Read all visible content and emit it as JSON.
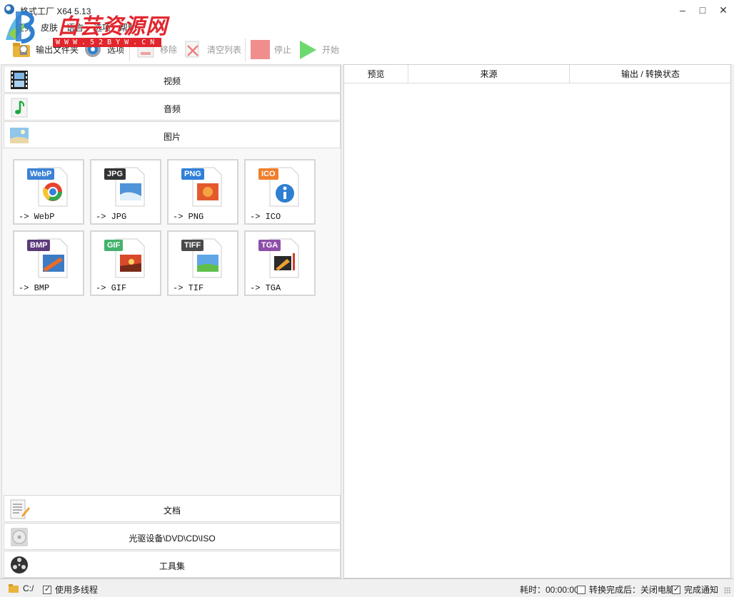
{
  "window": {
    "title": "格式工厂 X64 5.13",
    "minimize_glyph": "–",
    "maximize_glyph": "□",
    "close_glyph": "✕"
  },
  "watermark": {
    "text": "白芸资源网",
    "url": "WWW.52BYW.CN"
  },
  "menu": [
    "任务",
    "皮肤",
    "语言",
    "选项",
    "帮助"
  ],
  "toolbar": {
    "output_folder": "输出文件夹",
    "options": "选项",
    "remove": "移除",
    "clear_list": "清空列表",
    "stop": "停止",
    "start": "开始"
  },
  "categories_top": [
    {
      "label": "视频",
      "icon": "film-icon"
    },
    {
      "label": "音频",
      "icon": "music-note-icon"
    },
    {
      "label": "图片",
      "icon": "picture-icon"
    }
  ],
  "formats": [
    {
      "tag": "WebP",
      "label": "-> WebP",
      "color": "#3b82d6"
    },
    {
      "tag": "JPG",
      "label": "-> JPG",
      "color": "#333333"
    },
    {
      "tag": "PNG",
      "label": "-> PNG",
      "color": "#2f7fd9"
    },
    {
      "tag": "ICO",
      "label": "-> ICO",
      "color": "#f07f2a"
    },
    {
      "tag": "BMP",
      "label": "-> BMP",
      "color": "#5b3a7a"
    },
    {
      "tag": "GIF",
      "label": "-> GIF",
      "color": "#43b26c"
    },
    {
      "tag": "TIFF",
      "label": "-> TIF",
      "color": "#4a4a4a"
    },
    {
      "tag": "TGA",
      "label": "-> TGA",
      "color": "#8e4fa8"
    }
  ],
  "categories_bottom": [
    {
      "label": "文档",
      "icon": "document-icon"
    },
    {
      "label": "光驱设备\\DVD\\CD\\ISO",
      "icon": "disc-icon"
    },
    {
      "label": "工具集",
      "icon": "film-reel-icon"
    }
  ],
  "list_columns": [
    "预览",
    "来源",
    "输出 / 转换状态"
  ],
  "status": {
    "path": "C:/",
    "multithread": "使用多线程",
    "elapsed": "耗时：00:00:00",
    "after_convert": "转换完成后：关闭电脑",
    "notify": "完成通知"
  },
  "colors": {
    "watermark_red": "#e2262e",
    "start_green": "#5fd35f",
    "stop_red": "#f08080"
  }
}
